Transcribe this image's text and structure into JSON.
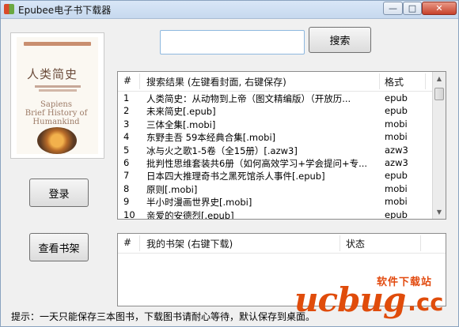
{
  "window": {
    "title": "Epubee电子书下载器",
    "buttons": {
      "minimize": "—",
      "maximize": "□",
      "close": "✕"
    }
  },
  "cover": {
    "title": "人类简史",
    "subtitle_en": "Sapiens\nBrief History of Humankind"
  },
  "buttons": {
    "login": "登录",
    "bookshelf": "查看书架",
    "search": "搜索"
  },
  "search": {
    "value": "",
    "placeholder": ""
  },
  "results": {
    "headers": {
      "num": "#",
      "name": "搜索结果 (左键看封面, 右键保存)",
      "format": "格式"
    },
    "rows": [
      {
        "num": "1",
        "name": "人类简史：从动物到上帝（图文精编版）（开放历...",
        "format": "epub"
      },
      {
        "num": "2",
        "name": "未来简史[.epub]",
        "format": "epub"
      },
      {
        "num": "3",
        "name": "三体全集[.mobi]",
        "format": "mobi"
      },
      {
        "num": "4",
        "name": "东野圭吾 59本经典合集[.mobi]",
        "format": "mobi"
      },
      {
        "num": "5",
        "name": "冰与火之歌1-5卷（全15册）[.azw3]",
        "format": "azw3"
      },
      {
        "num": "6",
        "name": "批判性思维套装共6册（如何高效学习+学会提问+专...",
        "format": "azw3"
      },
      {
        "num": "7",
        "name": "日本四大推理奇书之黑死馆杀人事件[.epub]",
        "format": "epub"
      },
      {
        "num": "8",
        "name": "原则[.mobi]",
        "format": "mobi"
      },
      {
        "num": "9",
        "name": "半小时漫画世界史[.mobi]",
        "format": "mobi"
      },
      {
        "num": "10",
        "name": "亲爱的安德烈[.epub]",
        "format": "epub"
      }
    ]
  },
  "shelf": {
    "headers": {
      "num": "#",
      "name": "我的书架 (右键下载)",
      "status": "状态"
    },
    "rows": []
  },
  "hint": "提示：一天只能保存三本图书，下载图书请耐心等待，默认保存到桌面。",
  "watermark": {
    "text": "软件下载站",
    "logo": "ucbug",
    "suffix": ".cc"
  }
}
